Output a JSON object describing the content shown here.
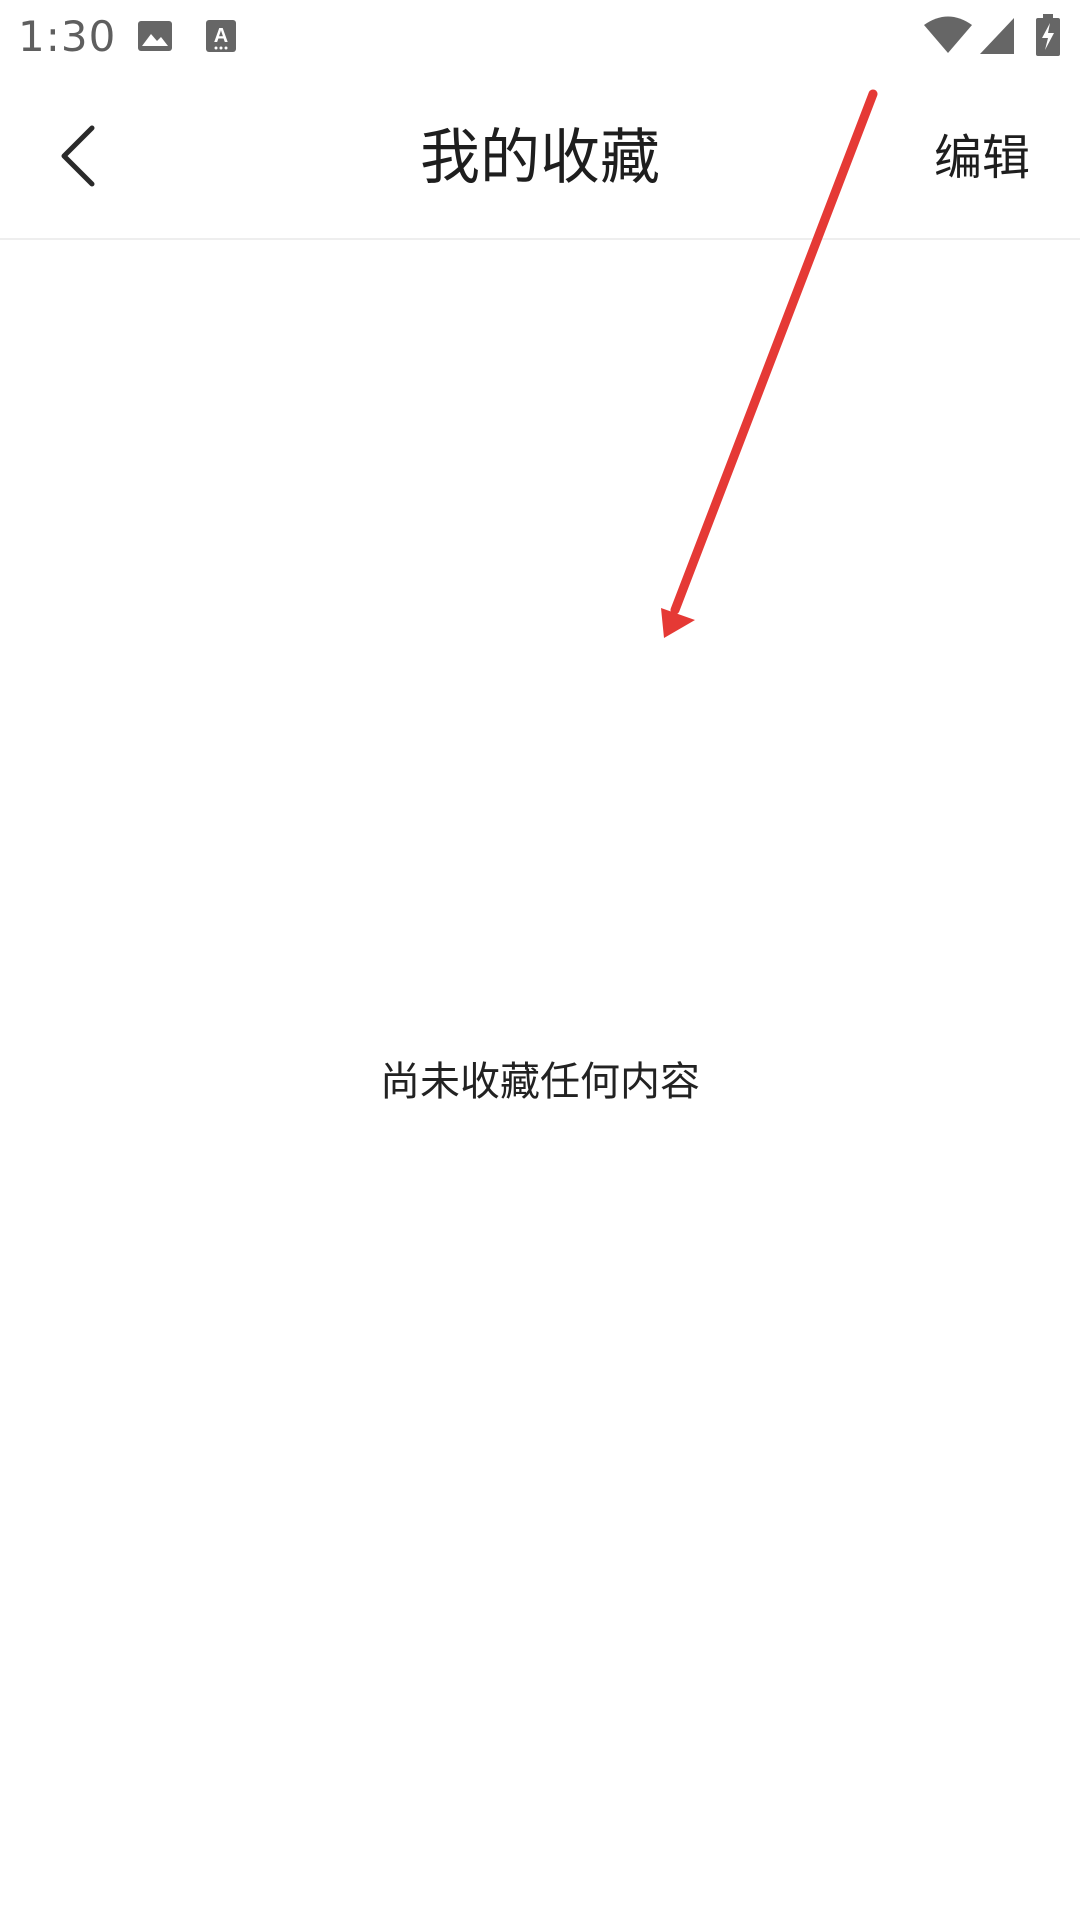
{
  "status_bar": {
    "time": "1:30",
    "icons": [
      "image-icon",
      "keyboard-a-icon",
      "wifi-icon",
      "cell-signal-icon",
      "battery-charging-icon"
    ]
  },
  "app_bar": {
    "title": "我的收藏",
    "edit_label": "编辑",
    "back_icon": "chevron-left-icon"
  },
  "empty_state": {
    "message": "尚未收藏任何内容"
  },
  "annotation": {
    "type": "arrow",
    "color": "#e53935"
  }
}
